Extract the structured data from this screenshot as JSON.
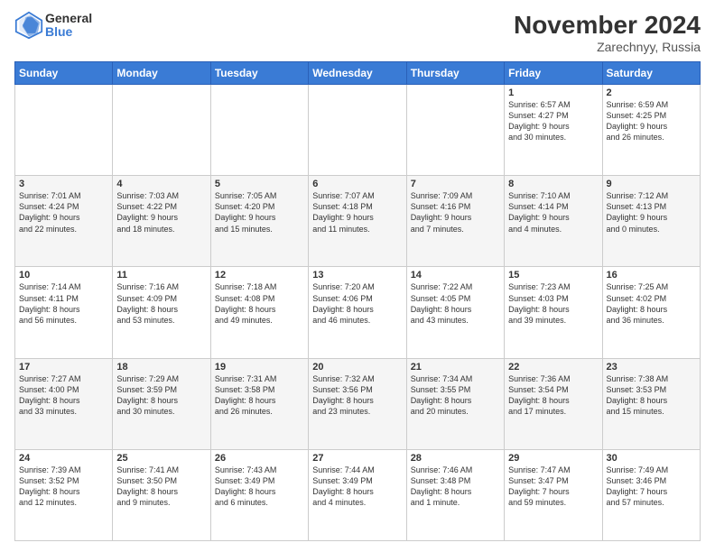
{
  "logo": {
    "general": "General",
    "blue": "Blue"
  },
  "header": {
    "month": "November 2024",
    "location": "Zarechnyy, Russia"
  },
  "weekdays": [
    "Sunday",
    "Monday",
    "Tuesday",
    "Wednesday",
    "Thursday",
    "Friday",
    "Saturday"
  ],
  "weeks": [
    [
      {
        "day": "",
        "info": ""
      },
      {
        "day": "",
        "info": ""
      },
      {
        "day": "",
        "info": ""
      },
      {
        "day": "",
        "info": ""
      },
      {
        "day": "",
        "info": ""
      },
      {
        "day": "1",
        "info": "Sunrise: 6:57 AM\nSunset: 4:27 PM\nDaylight: 9 hours\nand 30 minutes."
      },
      {
        "day": "2",
        "info": "Sunrise: 6:59 AM\nSunset: 4:25 PM\nDaylight: 9 hours\nand 26 minutes."
      }
    ],
    [
      {
        "day": "3",
        "info": "Sunrise: 7:01 AM\nSunset: 4:24 PM\nDaylight: 9 hours\nand 22 minutes."
      },
      {
        "day": "4",
        "info": "Sunrise: 7:03 AM\nSunset: 4:22 PM\nDaylight: 9 hours\nand 18 minutes."
      },
      {
        "day": "5",
        "info": "Sunrise: 7:05 AM\nSunset: 4:20 PM\nDaylight: 9 hours\nand 15 minutes."
      },
      {
        "day": "6",
        "info": "Sunrise: 7:07 AM\nSunset: 4:18 PM\nDaylight: 9 hours\nand 11 minutes."
      },
      {
        "day": "7",
        "info": "Sunrise: 7:09 AM\nSunset: 4:16 PM\nDaylight: 9 hours\nand 7 minutes."
      },
      {
        "day": "8",
        "info": "Sunrise: 7:10 AM\nSunset: 4:14 PM\nDaylight: 9 hours\nand 4 minutes."
      },
      {
        "day": "9",
        "info": "Sunrise: 7:12 AM\nSunset: 4:13 PM\nDaylight: 9 hours\nand 0 minutes."
      }
    ],
    [
      {
        "day": "10",
        "info": "Sunrise: 7:14 AM\nSunset: 4:11 PM\nDaylight: 8 hours\nand 56 minutes."
      },
      {
        "day": "11",
        "info": "Sunrise: 7:16 AM\nSunset: 4:09 PM\nDaylight: 8 hours\nand 53 minutes."
      },
      {
        "day": "12",
        "info": "Sunrise: 7:18 AM\nSunset: 4:08 PM\nDaylight: 8 hours\nand 49 minutes."
      },
      {
        "day": "13",
        "info": "Sunrise: 7:20 AM\nSunset: 4:06 PM\nDaylight: 8 hours\nand 46 minutes."
      },
      {
        "day": "14",
        "info": "Sunrise: 7:22 AM\nSunset: 4:05 PM\nDaylight: 8 hours\nand 43 minutes."
      },
      {
        "day": "15",
        "info": "Sunrise: 7:23 AM\nSunset: 4:03 PM\nDaylight: 8 hours\nand 39 minutes."
      },
      {
        "day": "16",
        "info": "Sunrise: 7:25 AM\nSunset: 4:02 PM\nDaylight: 8 hours\nand 36 minutes."
      }
    ],
    [
      {
        "day": "17",
        "info": "Sunrise: 7:27 AM\nSunset: 4:00 PM\nDaylight: 8 hours\nand 33 minutes."
      },
      {
        "day": "18",
        "info": "Sunrise: 7:29 AM\nSunset: 3:59 PM\nDaylight: 8 hours\nand 30 minutes."
      },
      {
        "day": "19",
        "info": "Sunrise: 7:31 AM\nSunset: 3:58 PM\nDaylight: 8 hours\nand 26 minutes."
      },
      {
        "day": "20",
        "info": "Sunrise: 7:32 AM\nSunset: 3:56 PM\nDaylight: 8 hours\nand 23 minutes."
      },
      {
        "day": "21",
        "info": "Sunrise: 7:34 AM\nSunset: 3:55 PM\nDaylight: 8 hours\nand 20 minutes."
      },
      {
        "day": "22",
        "info": "Sunrise: 7:36 AM\nSunset: 3:54 PM\nDaylight: 8 hours\nand 17 minutes."
      },
      {
        "day": "23",
        "info": "Sunrise: 7:38 AM\nSunset: 3:53 PM\nDaylight: 8 hours\nand 15 minutes."
      }
    ],
    [
      {
        "day": "24",
        "info": "Sunrise: 7:39 AM\nSunset: 3:52 PM\nDaylight: 8 hours\nand 12 minutes."
      },
      {
        "day": "25",
        "info": "Sunrise: 7:41 AM\nSunset: 3:50 PM\nDaylight: 8 hours\nand 9 minutes."
      },
      {
        "day": "26",
        "info": "Sunrise: 7:43 AM\nSunset: 3:49 PM\nDaylight: 8 hours\nand 6 minutes."
      },
      {
        "day": "27",
        "info": "Sunrise: 7:44 AM\nSunset: 3:49 PM\nDaylight: 8 hours\nand 4 minutes."
      },
      {
        "day": "28",
        "info": "Sunrise: 7:46 AM\nSunset: 3:48 PM\nDaylight: 8 hours\nand 1 minute."
      },
      {
        "day": "29",
        "info": "Sunrise: 7:47 AM\nSunset: 3:47 PM\nDaylight: 7 hours\nand 59 minutes."
      },
      {
        "day": "30",
        "info": "Sunrise: 7:49 AM\nSunset: 3:46 PM\nDaylight: 7 hours\nand 57 minutes."
      }
    ]
  ]
}
